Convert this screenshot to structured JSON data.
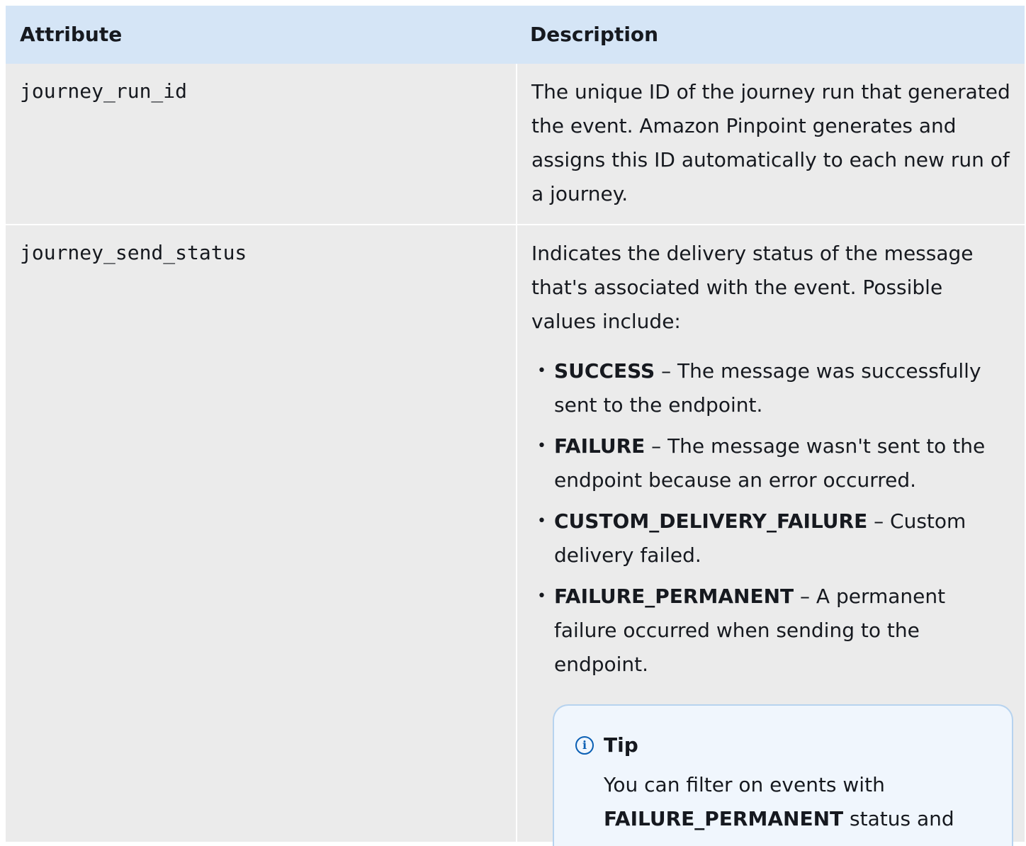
{
  "table": {
    "headers": {
      "attribute": "Attribute",
      "description": "Description"
    },
    "rows": [
      {
        "attribute": "journey_run_id",
        "description": "The unique ID of the journey run that generated the event. Amazon Pinpoint generates and assigns this ID automatically to each new run of a journey."
      },
      {
        "attribute": "journey_send_status",
        "description": "Indicates the delivery status of the message that's associated with the event. Possible values include:",
        "values": [
          {
            "name": "SUCCESS",
            "text": " – The message was successfully sent to the endpoint."
          },
          {
            "name": "FAILURE",
            "text": " – The message wasn't sent to the endpoint because an error occurred."
          },
          {
            "name": "CUSTOM_DELIVERY_FAILURE",
            "text": " – Custom delivery failed."
          },
          {
            "name": "FAILURE_PERMANENT",
            "text": " – A permanent failure occurred when sending to the endpoint."
          }
        ],
        "tip": {
          "icon": "info-icon",
          "title": "Tip",
          "text_before": "You can filter on events with ",
          "bold": "FAILURE_PERMANENT",
          "text_after": " status and"
        }
      }
    ]
  },
  "colors": {
    "header_bg": "#d5e5f6",
    "row_bg": "#ebebeb",
    "tip_bg": "#f0f6fd",
    "tip_border": "#b7d3ef",
    "info_icon": "#0a5fb4"
  }
}
